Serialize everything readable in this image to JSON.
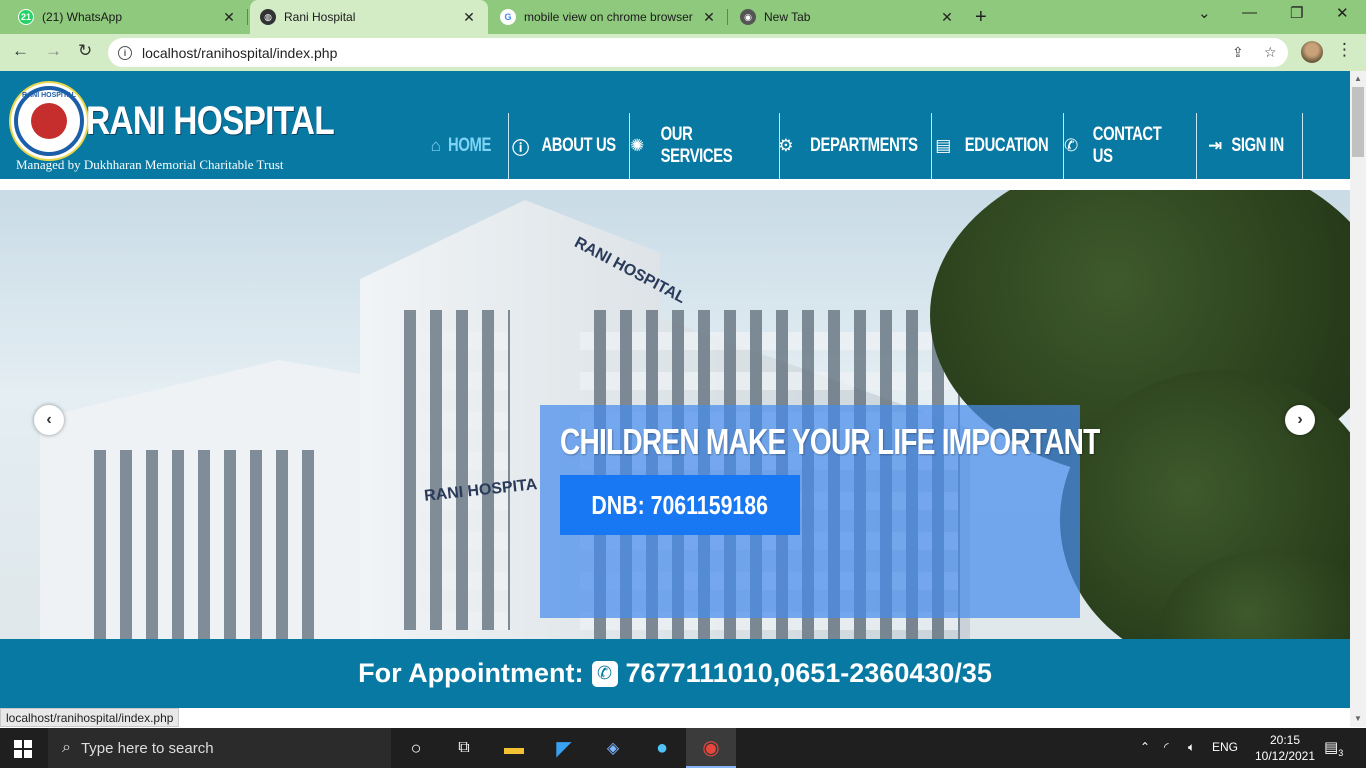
{
  "browser": {
    "tabs": [
      {
        "title": "(21) WhatsApp",
        "badge": "21"
      },
      {
        "title": "Rani Hospital"
      },
      {
        "title": "mobile view on chrome browser"
      },
      {
        "title": "New Tab"
      }
    ],
    "url": "localhost/ranihospital/index.php",
    "status_url": "localhost/ranihospital/index.php"
  },
  "site": {
    "brand": "RANI HOSPITAL",
    "tagline": "Managed by Dukhharan Memorial Charitable Trust",
    "logo_ring_text": "RANI HOSPITAL",
    "nav": [
      {
        "label": "HOME",
        "icon": "home-icon",
        "glyph": "⌂"
      },
      {
        "label": "ABOUT US",
        "icon": "info-icon",
        "glyph": "ⓘ"
      },
      {
        "label": "OUR SERVICES",
        "icon": "spinner-icon",
        "glyph": "✺"
      },
      {
        "label": "DEPARTMENTS",
        "icon": "gear-icon",
        "glyph": "⚙"
      },
      {
        "label": "EDUCATION",
        "icon": "book-icon",
        "glyph": "▤"
      },
      {
        "label": "CONTACT US",
        "icon": "phone-icon",
        "glyph": "✆"
      },
      {
        "label": "SIGN IN",
        "icon": "sign-in-icon",
        "glyph": "⇥"
      }
    ],
    "slider": {
      "caption_title": "CHILDREN MAKE YOUR LIFE IMPORTANT",
      "caption_button": "DNB: 7061159186",
      "building_sign_1": "RANI HOSPITAL",
      "building_sign_2": "RANI HOSPITA"
    },
    "appointment": {
      "label": "For Appointment:",
      "numbers": "7677111010,0651-2360430/35"
    }
  },
  "taskbar": {
    "search_placeholder": "Type here to search",
    "language": "ENG",
    "time": "20:15",
    "date": "10/12/2021",
    "notification_count": "3"
  },
  "colors": {
    "tabbar": "#8fc97d",
    "header": "#0779a3",
    "nav_active": "#7fd4f5",
    "caption_button": "#1877f2"
  }
}
